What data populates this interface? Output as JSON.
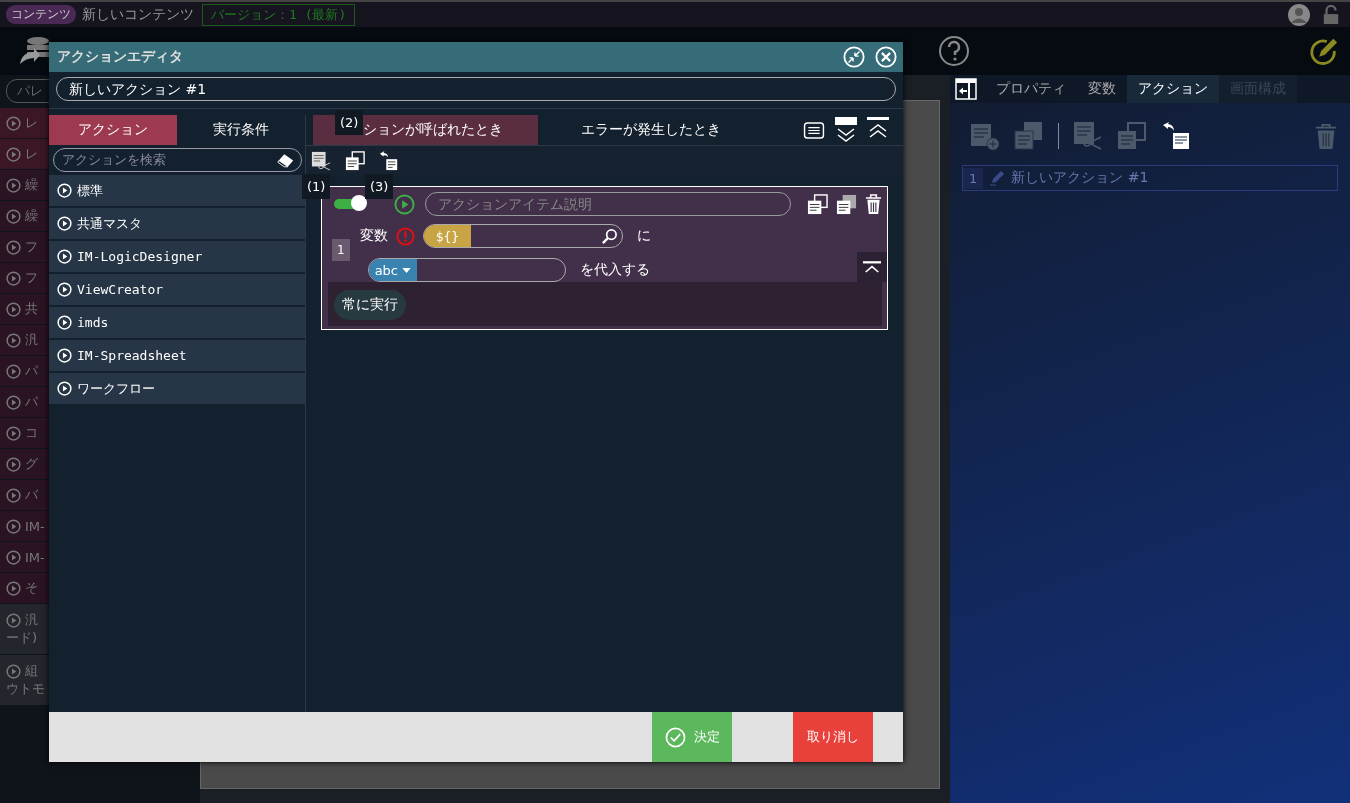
{
  "header": {
    "badge": "コンテンツ",
    "title": "新しいコンテンツ",
    "version": "バージョン：1 (最新)"
  },
  "palette": {
    "placeholder": "パレ",
    "items": [
      {
        "label": "レ",
        "color": "#3b1725"
      },
      {
        "label": "レ",
        "color": "#3b1725"
      },
      {
        "label": "繰",
        "color": "#2a1424"
      },
      {
        "label": "繰",
        "color": "#2a1424"
      },
      {
        "label": "フ",
        "color": "#2a1424"
      },
      {
        "label": "フ",
        "color": "#2a1424"
      },
      {
        "label": "共",
        "color": "#2a1424"
      },
      {
        "label": "汎",
        "color": "#2a1424"
      },
      {
        "label": "パ",
        "color": "#2a1424"
      },
      {
        "label": "パ",
        "color": "#2a1424"
      },
      {
        "label": "コ",
        "color": "#2a1424"
      },
      {
        "label": "グ",
        "color": "#2a1424"
      },
      {
        "label": "バ",
        "color": "#2a1424"
      },
      {
        "label": "IM-",
        "color": "#2a1424"
      },
      {
        "label": "IM-",
        "color": "#2a1424"
      },
      {
        "label": "そ",
        "color": "#2a1424"
      },
      {
        "label": "汎",
        "second": "ード)",
        "color": "#23262d"
      },
      {
        "label": "組",
        "second": "ウトモ",
        "color": "#23262d"
      }
    ]
  },
  "dialog": {
    "title": "アクションエディタ",
    "action_name": "新しいアクション #1",
    "tabs": [
      {
        "label": "アクション",
        "selected": true
      },
      {
        "label": "実行条件",
        "selected": false
      }
    ],
    "search_placeholder": "アクションを検索",
    "categories": [
      "標準",
      "共通マスタ",
      "IM-LogicDesigner",
      "ViewCreator",
      "imds",
      "IM-Spreadsheet",
      "ワークフロー"
    ],
    "event_tabs": [
      {
        "label": "ションが呼ばれたとき",
        "selected": true
      },
      {
        "label": "エラーが発生したとき",
        "selected": false
      }
    ],
    "item": {
      "on": true,
      "description_placeholder": "アクションアイテム説明",
      "number": "1",
      "variable_label": "変数",
      "token": "${}",
      "particle": "に",
      "type": "abc",
      "assign": "を代入する",
      "condition": "常に実行"
    },
    "annotations": [
      "(1)",
      "(2)",
      "(3)"
    ],
    "buttons": [
      {
        "label": "決定",
        "kind": "ok"
      },
      {
        "label": "取り消し",
        "kind": "cancel"
      }
    ]
  },
  "panel": {
    "tabs": [
      {
        "label": "プロパティ",
        "selected": false,
        "disabled": false
      },
      {
        "label": "変数",
        "selected": false,
        "disabled": false
      },
      {
        "label": "アクション",
        "selected": true,
        "disabled": false
      },
      {
        "label": "画面構成",
        "selected": false,
        "disabled": true
      }
    ],
    "actions": [
      {
        "number": "1",
        "label": "新しいアクション #1"
      }
    ]
  }
}
